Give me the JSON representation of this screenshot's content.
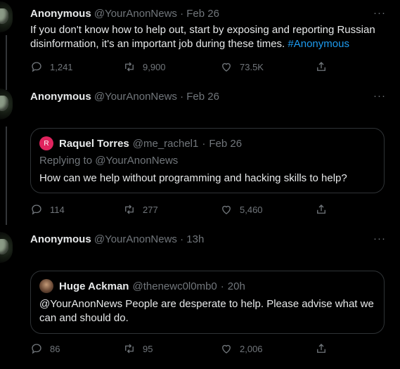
{
  "colors": {
    "background": "#000000",
    "text": "#e7e9ea",
    "muted": "#71767b",
    "accent": "#1d9bf0",
    "border": "#2f3336"
  },
  "tweets": [
    {
      "name": "Anonymous",
      "handle": "@YourAnonNews",
      "sep": "·",
      "time": "Feb 26",
      "more": "···",
      "text": "If you don't know how to help out, start by exposing and reporting Russian disinformation, it's an important job during these times.",
      "hashtag": "#Anonymous",
      "replies": "1,241",
      "retweets": "9,900",
      "likes": "73.5K"
    },
    {
      "name": "Anonymous",
      "handle": "@YourAnonNews",
      "sep": "·",
      "time": "Feb 26",
      "more": "···",
      "quote": {
        "avatar_letter": "R",
        "name": "Raquel Torres",
        "handle": "@me_rachel1",
        "sep": "·",
        "time": "Feb 26",
        "replying_prefix": "Replying to",
        "replying_to": "@YourAnonNews",
        "text": "How can we help without programming and hacking skills to help?"
      },
      "replies": "114",
      "retweets": "277",
      "likes": "5,460"
    },
    {
      "name": "Anonymous",
      "handle": "@YourAnonNews",
      "sep": "·",
      "time": "13h",
      "more": "···",
      "quote": {
        "name": "Huge Ackman",
        "handle": "@thenewc0l0mb0",
        "sep": "·",
        "time": "20h",
        "text": "@YourAnonNews People are desperate to help. Please advise what we can and should do."
      },
      "replies": "86",
      "retweets": "95",
      "likes": "2,006"
    }
  ],
  "icons": {
    "reply": "reply-icon",
    "retweet": "retweet-icon",
    "like": "heart-icon",
    "share": "share-icon"
  }
}
